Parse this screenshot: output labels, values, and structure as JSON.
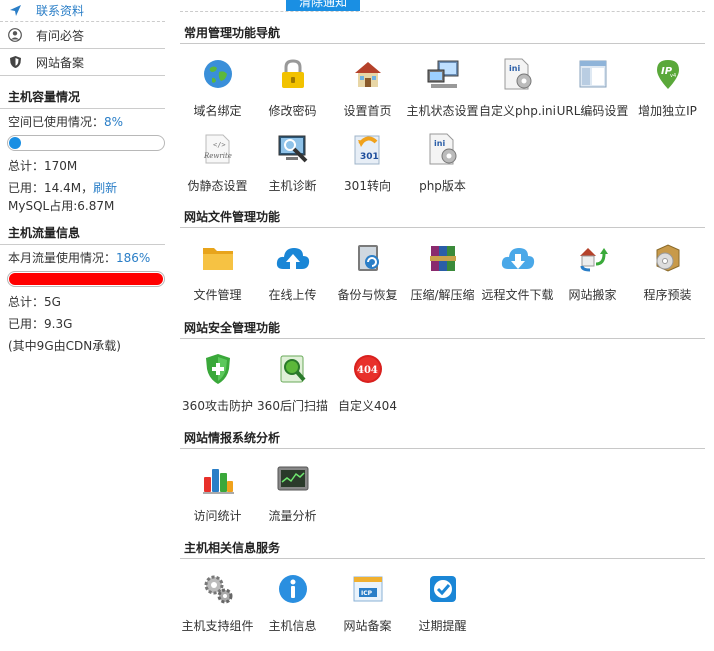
{
  "sidebar": {
    "links": [
      {
        "label": "联系资料",
        "icon": "send-icon"
      },
      {
        "label": "有问必答",
        "icon": "user-icon"
      },
      {
        "label": "网站备案",
        "icon": "shield-icon"
      }
    ],
    "capacity": {
      "title": "主机容量情况",
      "usage_label": "空间已使用情况：",
      "usage_pct": "8%",
      "usage_fraction": 0.08,
      "total": "总计：170M",
      "used": "已用：14.4M，",
      "refresh": "刷新",
      "mysql": "MySQL占用:6.87M"
    },
    "traffic": {
      "title": "主机流量信息",
      "usage_label": "本月流量使用情况：",
      "usage_pct": "186%",
      "usage_fraction": 1.0,
      "total": "总计：5G",
      "used": "已用：9.3G",
      "note": "(其中9G由CDN承载)"
    }
  },
  "notice_button": "清除通知",
  "sections": [
    {
      "title": "常用管理功能导航",
      "items": [
        "域名绑定",
        "修改密码",
        "设置首页",
        "主机状态设置",
        "自定义php.ini",
        "URL编码设置",
        "增加独立IP",
        "伪静态设置",
        "主机诊断",
        "301转向",
        "php版本"
      ]
    },
    {
      "title": "网站文件管理功能",
      "items": [
        "文件管理",
        "在线上传",
        "备份与恢复",
        "压缩/解压缩",
        "远程文件下载",
        "网站搬家",
        "程序预装"
      ]
    },
    {
      "title": "网站安全管理功能",
      "items": [
        "360攻击防护",
        "360后门扫描",
        "自定义404"
      ]
    },
    {
      "title": "网站情报系统分析",
      "items": [
        "访问统计",
        "流量分析"
      ]
    },
    {
      "title": "主机相关信息服务",
      "items": [
        "主机支持组件",
        "主机信息",
        "网站备案",
        "过期提醒"
      ]
    }
  ],
  "icons": {
    "ini": "ini",
    "ip": "IP",
    "v4": "v4",
    "rewrite": "Rewrite",
    "code": "</>",
    "r301": "301",
    "e404": "404",
    "icp": "ICP"
  }
}
